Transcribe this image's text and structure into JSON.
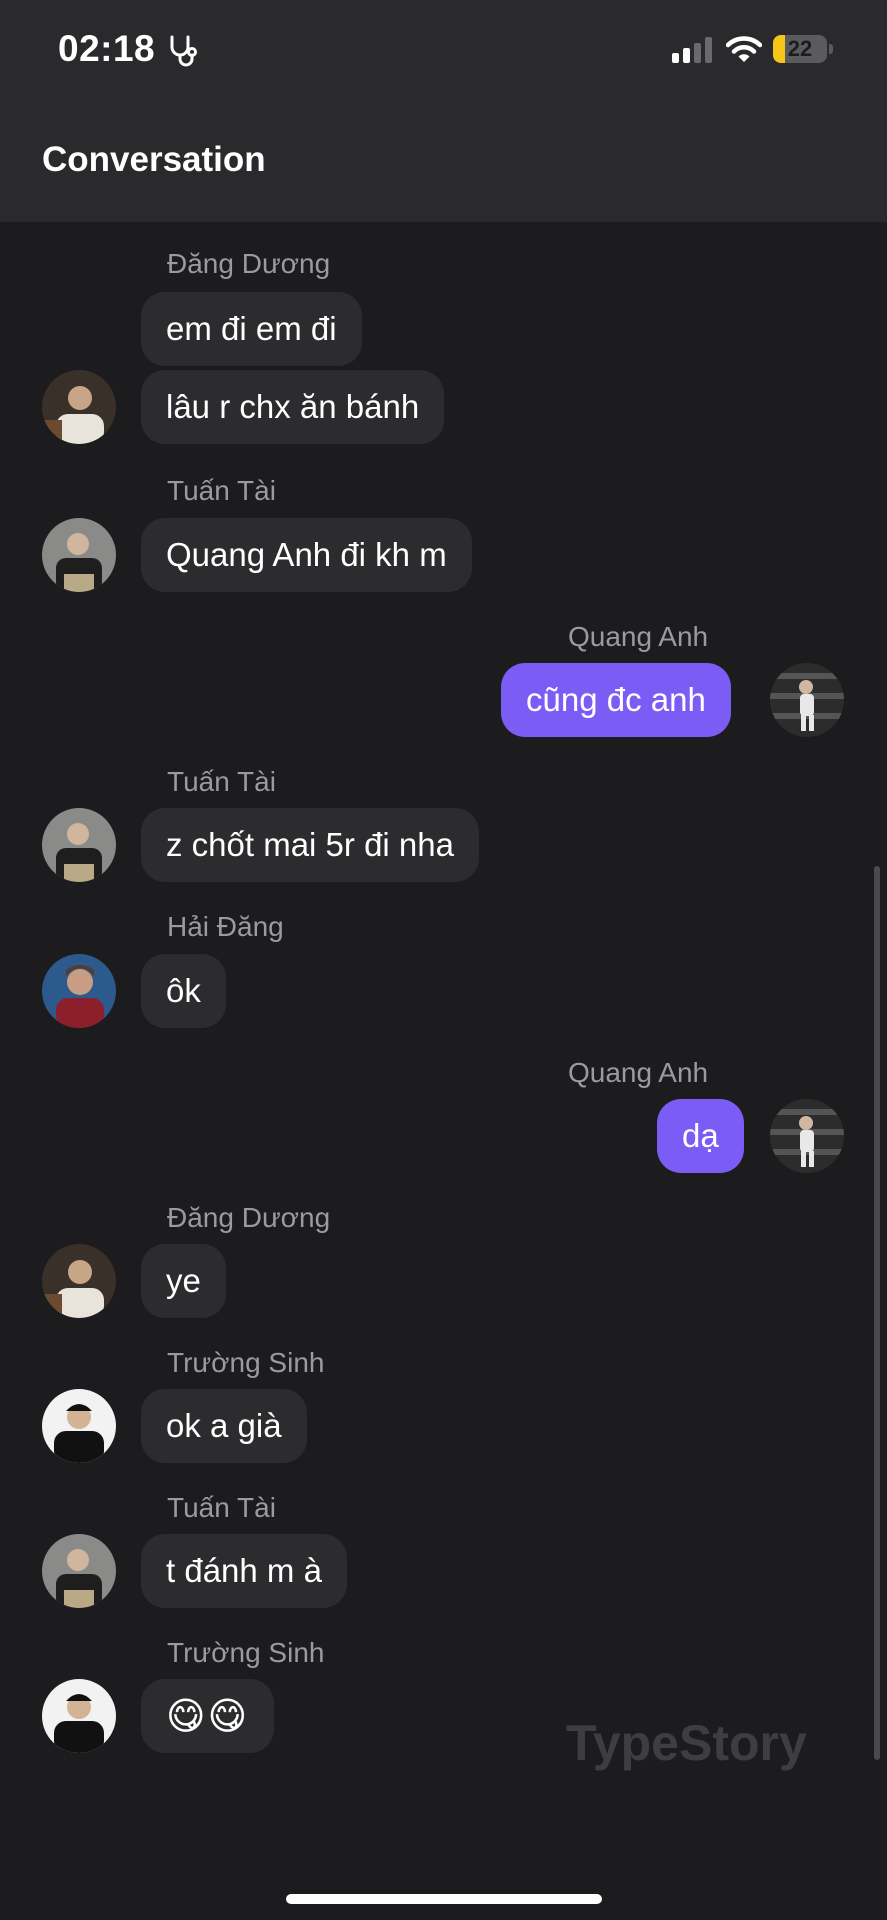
{
  "status_bar": {
    "time": "02:18",
    "battery": "22",
    "battery_level": 0.22
  },
  "header": {
    "title": "Conversation"
  },
  "messages": [
    {
      "sender": "Đăng Dương",
      "text": "em đi em đi"
    },
    {
      "sender": "",
      "text": "lâu r chx ăn bánh"
    },
    {
      "sender": "Tuấn Tài",
      "text": "Quang Anh đi kh m"
    },
    {
      "sender": "Quang Anh",
      "text": "cũng đc anh"
    },
    {
      "sender": "Tuấn Tài",
      "text": "z chốt mai 5r đi nha"
    },
    {
      "sender": "Hải Đăng",
      "text": "ôk"
    },
    {
      "sender": "Quang Anh",
      "text": "dạ"
    },
    {
      "sender": "Đăng Dương",
      "text": "ye"
    },
    {
      "sender": "Trường Sinh",
      "text": "ok a già"
    },
    {
      "sender": "Tuấn Tài",
      "text": "t đánh m à"
    },
    {
      "sender": "Trường Sinh",
      "text": "😋😋"
    }
  ],
  "watermark": "TypeStory",
  "colors": {
    "outgoing_bubble": "#7b5cf5",
    "incoming_bubble": "#2c2c2e",
    "background": "#1c1c1e"
  }
}
